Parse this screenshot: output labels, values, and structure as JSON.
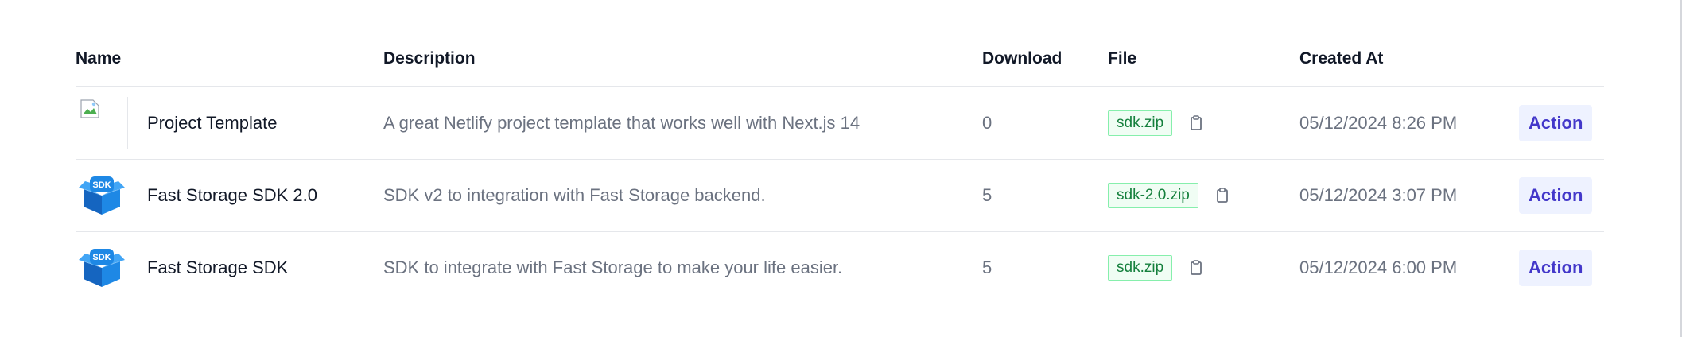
{
  "table": {
    "headers": {
      "name": "Name",
      "description": "Description",
      "download": "Download",
      "file": "File",
      "created_at": "Created At",
      "action": ""
    },
    "rows": [
      {
        "name": "Project Template",
        "thumbnail": "broken-image-icon",
        "description": "A great Netlify project template that works well with Next.js 14",
        "download": "0",
        "file": "sdk.zip",
        "created_at": "05/12/2024 8:26 PM",
        "action": "Action"
      },
      {
        "name": "Fast Storage SDK 2.0",
        "thumbnail": "sdk-box-icon",
        "thumbnail_label": "SDK",
        "description": "SDK v2 to integration with Fast Storage backend.",
        "download": "5",
        "file": "sdk-2.0.zip",
        "created_at": "05/12/2024 3:07 PM",
        "action": "Action"
      },
      {
        "name": "Fast Storage SDK",
        "thumbnail": "sdk-box-icon",
        "thumbnail_label": "SDK",
        "description": "SDK to integrate with Fast Storage to make your life easier.",
        "download": "5",
        "file": "sdk.zip",
        "created_at": "05/12/2024 6:00 PM",
        "action": "Action"
      }
    ]
  },
  "colors": {
    "accent": "#4338ca",
    "accent_bg": "#eef2ff",
    "file_text": "#15803d",
    "file_bg": "#f0fdf4",
    "sdk_blue": "#1e88e5"
  }
}
